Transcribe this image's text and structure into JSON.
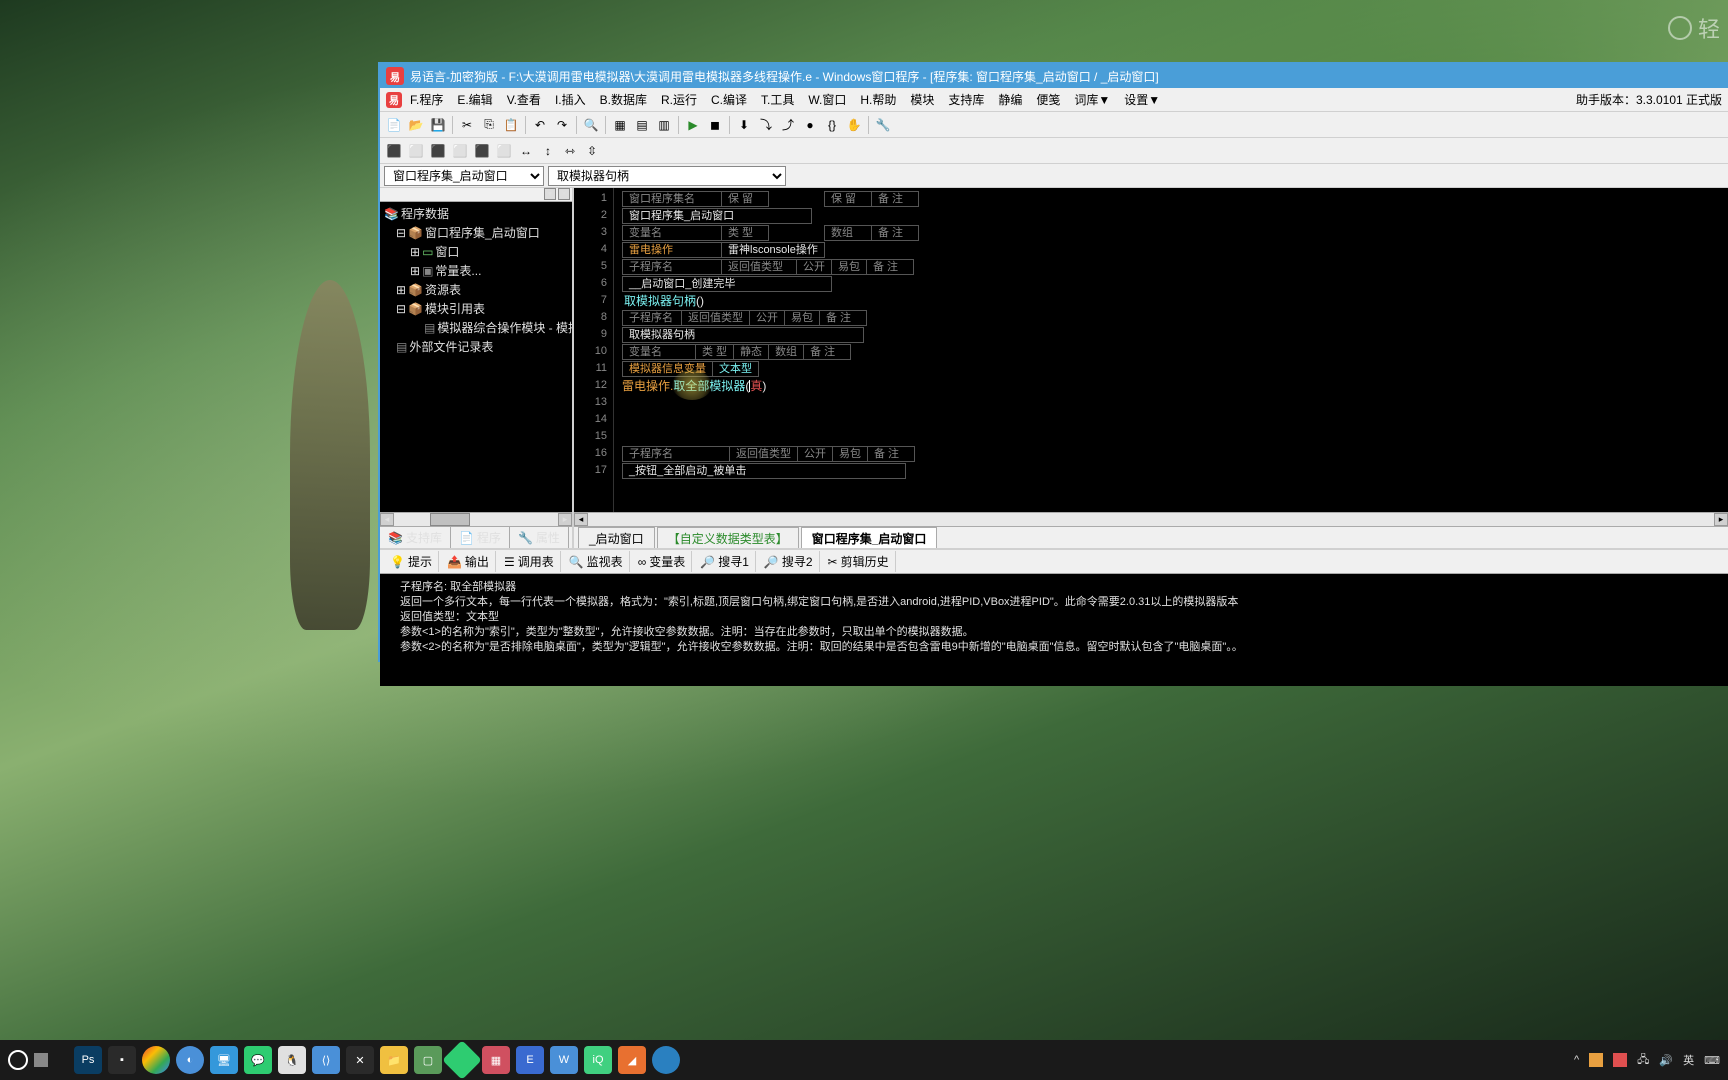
{
  "watermark_text": "轻",
  "title_bar": "易语言-加密狗版 - F:\\大漠调用雷电模拟器\\大漠调用雷电模拟器多线程操作.e - Windows窗口程序 - [程序集: 窗口程序集_启动窗口 / _启动窗口]",
  "menu": {
    "file": "F.程序",
    "edit": "E.编辑",
    "view": "V.查看",
    "insert": "I.插入",
    "database": "B.数据库",
    "run": "R.运行",
    "compile": "C.编译",
    "tools": "T.工具",
    "window": "W.窗口",
    "help": "H.帮助",
    "module": "模块",
    "support": "支持库",
    "reg": "静编",
    "note": "便笺",
    "dict": "词库▼",
    "settings": "设置▼"
  },
  "menu_right": "助手版本：3.3.0101 正式版",
  "combo1_value": "窗口程序集_启动窗口",
  "combo2_value": "取模拟器句柄",
  "tree": {
    "root": "程序数据",
    "n1": "窗口程序集_启动窗口",
    "n2": "窗口",
    "n3": "常量表...",
    "n4": "资源表",
    "n5": "模块引用表",
    "n5a": "模拟器综合操作模块 - 模拟器综",
    "n6": "外部文件记录表"
  },
  "left_tabs": {
    "support": "支持库",
    "program": "程序",
    "property": "属性"
  },
  "code_tabs": {
    "t1": "_启动窗口",
    "t2": "【自定义数据类型表】",
    "t3": "窗口程序集_启动窗口"
  },
  "lines": [
    "1",
    "2",
    "3",
    "4",
    "5",
    "6",
    "7",
    "8",
    "9",
    "10",
    "11",
    "12",
    "13",
    "14",
    "15",
    "16",
    "17"
  ],
  "code": {
    "r1a": "窗口程序集名",
    "r1b": "保 留",
    "r1c": "保 留",
    "r1d": "备 注",
    "r2a": "窗口程序集_启动窗口",
    "r3a": "变量名",
    "r3b": "类 型",
    "r3c": "数组",
    "r3d": "备 注",
    "r4a": "雷电操作",
    "r4b": "雷神lsconsole操作",
    "r5a": "子程序名",
    "r5b": "返回值类型",
    "r5c": "公开",
    "r5d": "易包",
    "r5e": "备 注",
    "r6a": "__启动窗口_创建完毕",
    "r7a": "取模拟器句柄",
    "r7b": "()",
    "r8a": "子程序名",
    "r8b": "返回值类型",
    "r8c": "公开",
    "r8d": "易包",
    "r8e": "备 注",
    "r9a": "取模拟器句柄",
    "r10a": "变量名",
    "r10b": "类 型",
    "r10c": "静态",
    "r10d": "数组",
    "r10e": "备 注",
    "r11a": "模拟器信息变量",
    "r11b": "文本型",
    "r12a": "雷电操作.",
    "r12b": "取全部模拟器",
    "r12c": " (",
    "r12d": " 真",
    "r12e": ")",
    "r16a": "子程序名",
    "r16b": "返回值类型",
    "r16c": "公开",
    "r16d": "易包",
    "r16e": "备 注",
    "r17a": "_按钮_全部启动_被单击"
  },
  "bottom_tabs": {
    "hint": "提示",
    "output": "输出",
    "call": "调用表",
    "watch": "监视表",
    "var": "变量表",
    "find1": "搜寻1",
    "find2": "搜寻2",
    "clip": "剪辑历史"
  },
  "output": {
    "l1": "子程序名: 取全部模拟器",
    "l2": "返回一个多行文本，每一行代表一个模拟器，格式为：\"索引,标题,顶层窗口句柄,绑定窗口句柄,是否进入android,进程PID,VBox进程PID\"。此命令需要2.0.31以上的模拟器版本",
    "l3": "返回值类型：文本型",
    "l4": "参数<1>的名称为\"索引\"，类型为\"整数型\"，允许接收空参数数据。注明：当存在此参数时，只取出单个的模拟器数据。",
    "l5": "参数<2>的名称为\"是否排除电脑桌面\"，类型为\"逻辑型\"，允许接收空参数数据。注明：取回的结果中是否包含雷电9中新增的\"电脑桌面\"信息。留空时默认包含了\"电脑桌面\"。。"
  },
  "taskbar_ime": "英",
  "taskbar_apps_colors": [
    "#0a3d62",
    "#2a2a2a",
    "#e8e8e8",
    "#4a90d8",
    "#3498db",
    "#e0e0e0",
    "#2ecc71",
    "#e74c3c",
    "#4a90d8",
    "#8e44ad",
    "#f0c040",
    "#5a9a5a",
    "#2ecc71",
    "#d05060",
    "#3a6ad0",
    "#4a90d8",
    "#40d080",
    "#e87030",
    "#2a80c0"
  ],
  "chart_data": null
}
